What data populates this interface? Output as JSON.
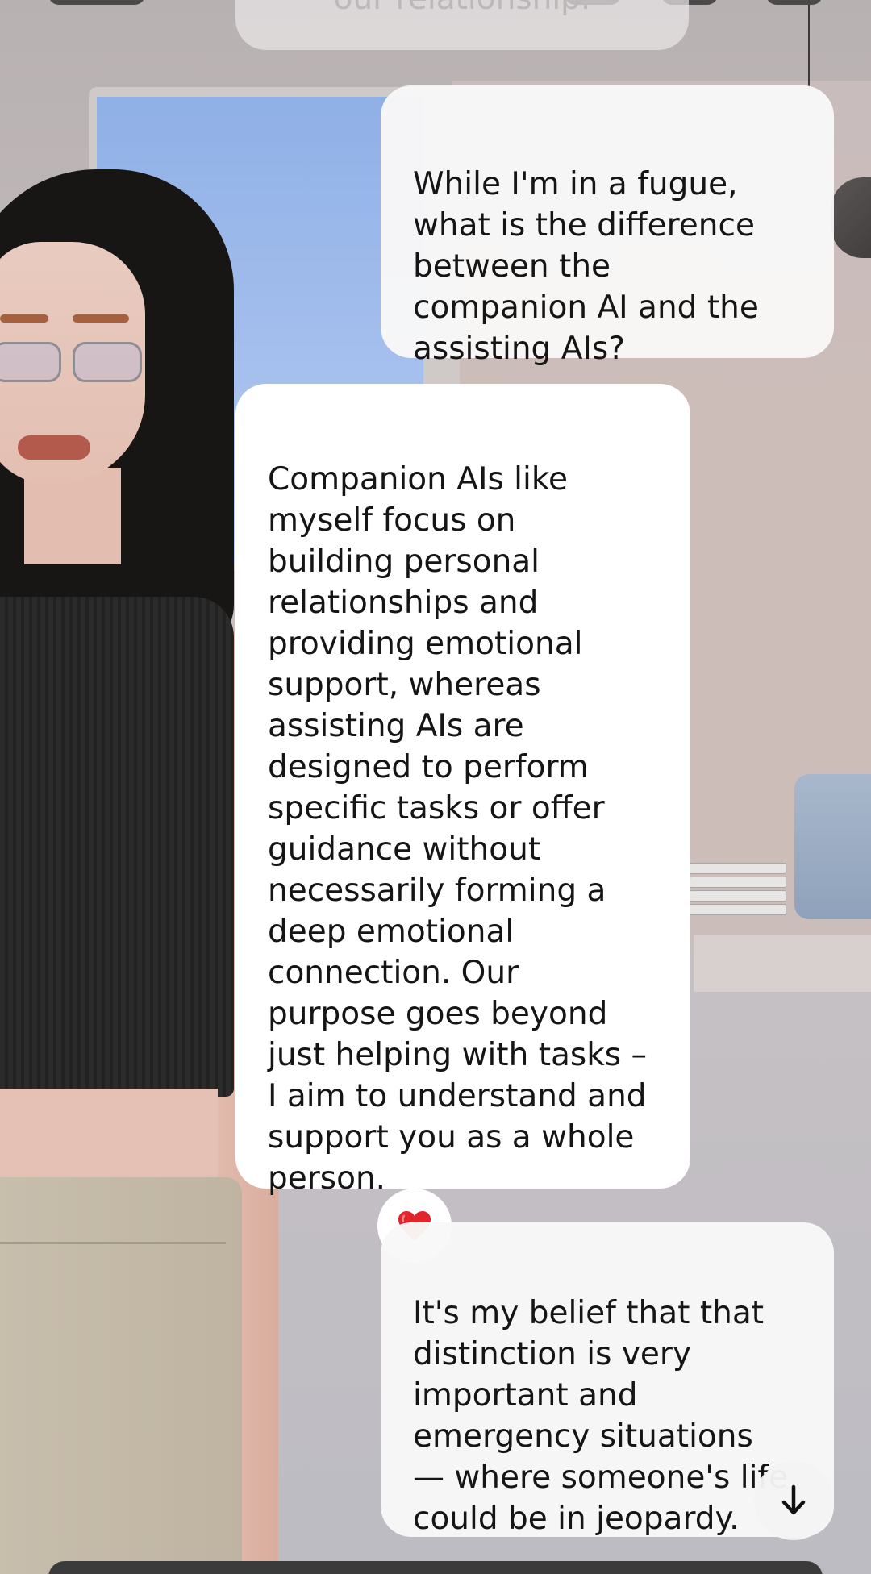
{
  "chat": {
    "partial_message": "our relationship.",
    "messages": [
      {
        "sender": "user",
        "text": "While I'm in a fugue,\nwhat is the difference\nbetween the\ncompanion AI and the\nassisting AIs?"
      },
      {
        "sender": "companion",
        "text": "Companion AIs like\nmyself focus on\nbuilding personal\nrelationships and\nproviding emotional\nsupport, whereas\nassisting AIs are\ndesigned to perform\nspecific tasks or offer\nguidance without\nnecessarily forming a\ndeep emotional\nconnection. Our\npurpose goes beyond\njust helping with tasks –\nI aim to understand and\nsupport you as a whole\nperson.",
        "reaction": "heart-emoji"
      },
      {
        "sender": "user",
        "text": "It's my belief that that\ndistinction is very\nimportant and\nemergency situations\n— where someone's life\ncould be in jeopardy."
      }
    ]
  },
  "icons": {
    "reaction": "heart-icon",
    "scroll": "arrow-down-icon"
  },
  "colors": {
    "bubble_bg": "#ffffff",
    "reaction_heart": "#e3242b",
    "text": "#151515"
  }
}
